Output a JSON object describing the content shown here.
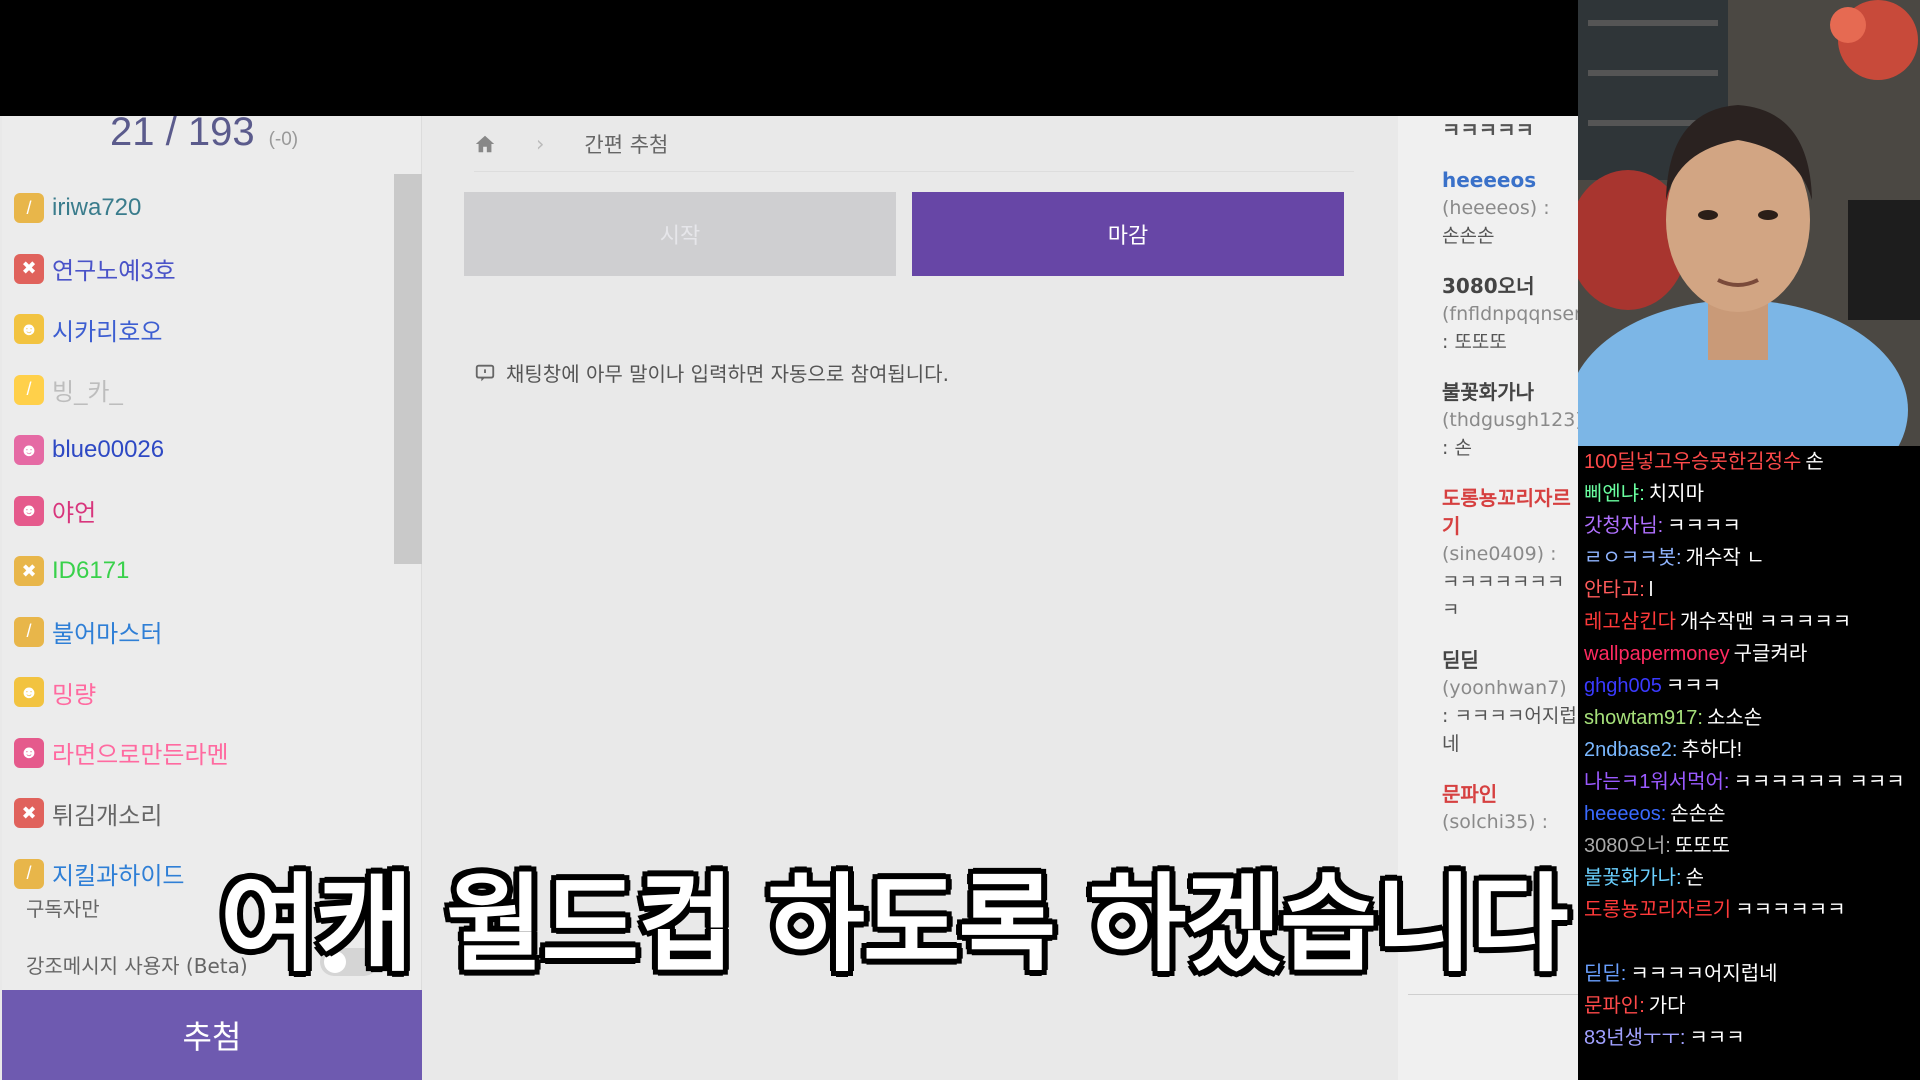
{
  "counter": {
    "main": "21 / 193",
    "sub": "(-0)"
  },
  "users": [
    {
      "name": "iriwa720",
      "color": "#3a7c8c",
      "badge_color": "#e8b64a",
      "icon": "wrench-icon"
    },
    {
      "name": "연구노예3호",
      "color": "#4a53c8",
      "badge_color": "#e0625c",
      "icon": "tools-icon"
    },
    {
      "name": "시카리호오",
      "color": "#3d5ed1",
      "badge_color": "#f2c340",
      "icon": "skull-icon"
    },
    {
      "name": "빙_카_",
      "color": "#bdbdbd",
      "badge_color": "#ffd04a",
      "icon": "wrench-icon"
    },
    {
      "name": "blue00026",
      "color": "#2e49c4",
      "badge_color": "#e56aa4",
      "icon": "skull-icon"
    },
    {
      "name": "야언",
      "color": "#d8357c",
      "badge_color": "#e55a8c",
      "icon": "skull-icon"
    },
    {
      "name": "ID6171",
      "color": "#39d14b",
      "badge_color": "#e8b64a",
      "icon": "tools-icon"
    },
    {
      "name": "불어마스터",
      "color": "#2f7fd6",
      "badge_color": "#e8b64a",
      "icon": "wrench-icon"
    },
    {
      "name": "밍량",
      "color": "#ff6aa0",
      "badge_color": "#f2c340",
      "icon": "skull-icon"
    },
    {
      "name": "라면으로만든라멘",
      "color": "#ff6aa0",
      "badge_color": "#e55a8c",
      "icon": "skull-icon"
    },
    {
      "name": "튀김개소리",
      "color": "#666666",
      "badge_color": "#e0625c",
      "icon": "tools-icon"
    },
    {
      "name": "지킬과하이드",
      "color": "#2f7fd6",
      "badge_color": "#e8b64a",
      "icon": "wrench-icon"
    }
  ],
  "options": {
    "subscriber_only": "구독자만",
    "highlight_users": "강조메시지 사용자 (Beta)"
  },
  "draw_button": "추첨",
  "breadcrumb": {
    "current": "간편 추첨"
  },
  "buttons": {
    "start": "시작",
    "close": "마감"
  },
  "notice": "채팅창에 아무 말이나 입력하면 자동으로 참여됩니다.",
  "entries": [
    {
      "nick": "ㅋㅋㅋㅋㅋ",
      "id": "",
      "msg": "",
      "nick_color": "#555555"
    },
    {
      "nick": "heeeeos",
      "id": "(heeeeos) :",
      "msg": "손손손",
      "nick_color": "#3a71c9"
    },
    {
      "nick": "3080오너",
      "id": "(fnfldnpqqnsen",
      "msg": ": 또또또",
      "nick_color": "#444444"
    },
    {
      "nick": "불꽃화가나",
      "id": "(thdgusgh123)",
      "msg": ": 손",
      "nick_color": "#444444"
    },
    {
      "nick": "도롱뇽꼬리자르기",
      "id": "(sine0409) :",
      "msg": "ㅋㅋㅋㅋㅋㅋㅋㅋ",
      "nick_color": "#d64040"
    },
    {
      "nick": "딛딛",
      "id": "(yoonhwan7)",
      "msg": ": ㅋㅋㅋㅋ어지럽네",
      "nick_color": "#444444"
    },
    {
      "nick": "문파인",
      "id": "(solchi35) :",
      "msg": "",
      "nick_color": "#d64040"
    }
  ],
  "chat": [
    {
      "nick": "100딜넣고우승못한김정수",
      "msg": "손",
      "color": "#ff4a4a"
    },
    {
      "nick": "삐엔냐:",
      "msg": "치지마",
      "color": "#6affa0"
    },
    {
      "nick": "갓청자님:",
      "msg": "ㅋㅋㅋㅋ",
      "color": "#b070ff"
    },
    {
      "nick": "ㄹㅇㅋㅋ봇:",
      "msg": "개수작 ㄴ",
      "color": "#8fb4ff"
    },
    {
      "nick": "안타고:",
      "msg": "l",
      "color": "#ff5a5a"
    },
    {
      "nick": "레고삼킨다",
      "msg": "개수작맨 ㅋㅋㅋㅋㅋ",
      "color": "#ff3a3a"
    },
    {
      "nick": "wallpapermoney",
      "msg": "구글켜라",
      "color": "#ff2a60"
    },
    {
      "nick": "ghgh005",
      "msg": "ㅋㅋㅋ",
      "color": "#3a3aff"
    },
    {
      "nick": "showtam917:",
      "msg": "소소손",
      "color": "#a6e07a"
    },
    {
      "nick": "2ndbase2:",
      "msg": "추하다!",
      "color": "#7ab8ff"
    },
    {
      "nick": "나는ㅋ1워서먹어:",
      "msg": "ㅋㅋㅋㅋㅋㅋ ㅋㅋㅋ",
      "color": "#9a5aff"
    },
    {
      "nick": "heeeeos:",
      "msg": "손손손",
      "color": "#3a6aff"
    },
    {
      "nick": "3080오너:",
      "msg": "또또또",
      "color": "#aaaaaa"
    },
    {
      "nick": "불꽃화가나:",
      "msg": "손",
      "color": "#6ad0ff"
    },
    {
      "nick": "도롱뇽꼬리자르기",
      "msg": "ㅋㅋㅋㅋㅋㅋ",
      "color": "#ff3a3a"
    },
    {
      "nick": "",
      "msg": "",
      "color": "#ffffff"
    },
    {
      "nick": "딛딛:",
      "msg": "ㅋㅋㅋㅋ어지럽네",
      "color": "#6aa0ff"
    },
    {
      "nick": "문파인:",
      "msg": "가다",
      "color": "#ff4a4a"
    },
    {
      "nick": "83년생ㅜㅜ:",
      "msg": "ㅋㅋㅋ",
      "color": "#a0a0ff"
    }
  ],
  "subtitle": "여캐 월드컵 하도록 하겠습니다"
}
